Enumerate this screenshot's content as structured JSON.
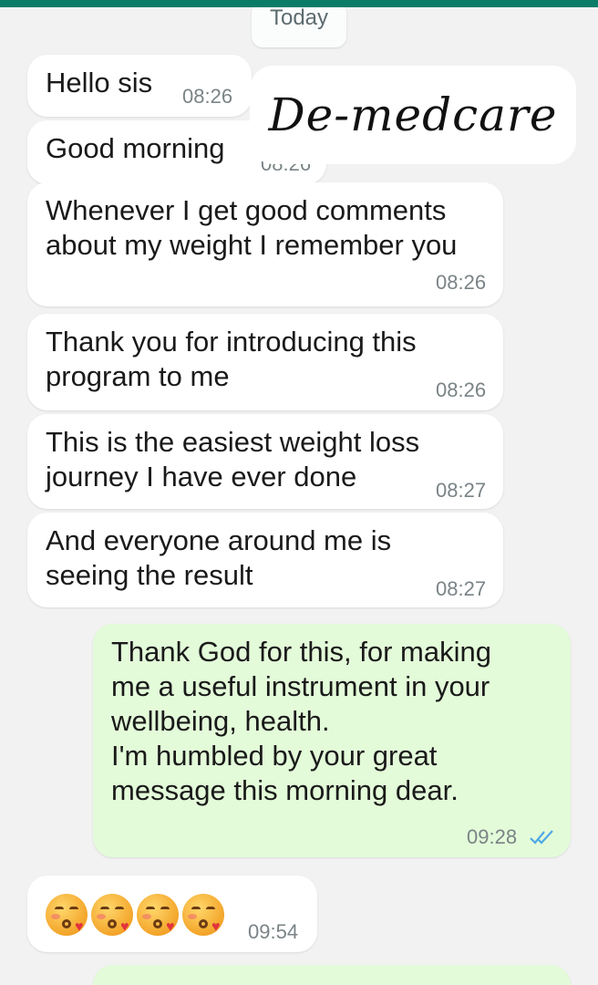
{
  "colors": {
    "top_bar": "#0b7c68",
    "background": "#f2f2f2",
    "incoming_bubble": "#ffffff",
    "outgoing_bubble": "#e3fbd9",
    "read_ticks": "#4fa8e6"
  },
  "day_separator": "Today",
  "watermark": "De-medcare",
  "messages": [
    {
      "direction": "incoming",
      "text": "Hello sis",
      "time": "08:26"
    },
    {
      "direction": "incoming",
      "text": "Good morning",
      "time": "08:26"
    },
    {
      "direction": "incoming",
      "text": "Whenever I get good comments\nabout my weight I remember you",
      "time": "08:26"
    },
    {
      "direction": "incoming",
      "text": "Thank you for introducing this\nprogram to me",
      "time": "08:26"
    },
    {
      "direction": "incoming",
      "text": "This is the easiest weight loss\njourney I have ever done",
      "time": "08:27"
    },
    {
      "direction": "incoming",
      "text": "And everyone around me is\nseeing the result",
      "time": "08:27"
    },
    {
      "direction": "outgoing",
      "text": "Thank God for this, for making\nme a useful instrument in your\nwellbeing, health.\nI'm humbled by your great\nmessage this morning dear.",
      "time": "09:28",
      "status_icon": "double-check-read-icon"
    },
    {
      "direction": "incoming",
      "emoji": [
        "kissing-face-with-heart",
        "kissing-face-with-heart",
        "kissing-face-with-heart",
        "kissing-face-with-heart"
      ],
      "time": "09:54"
    }
  ]
}
